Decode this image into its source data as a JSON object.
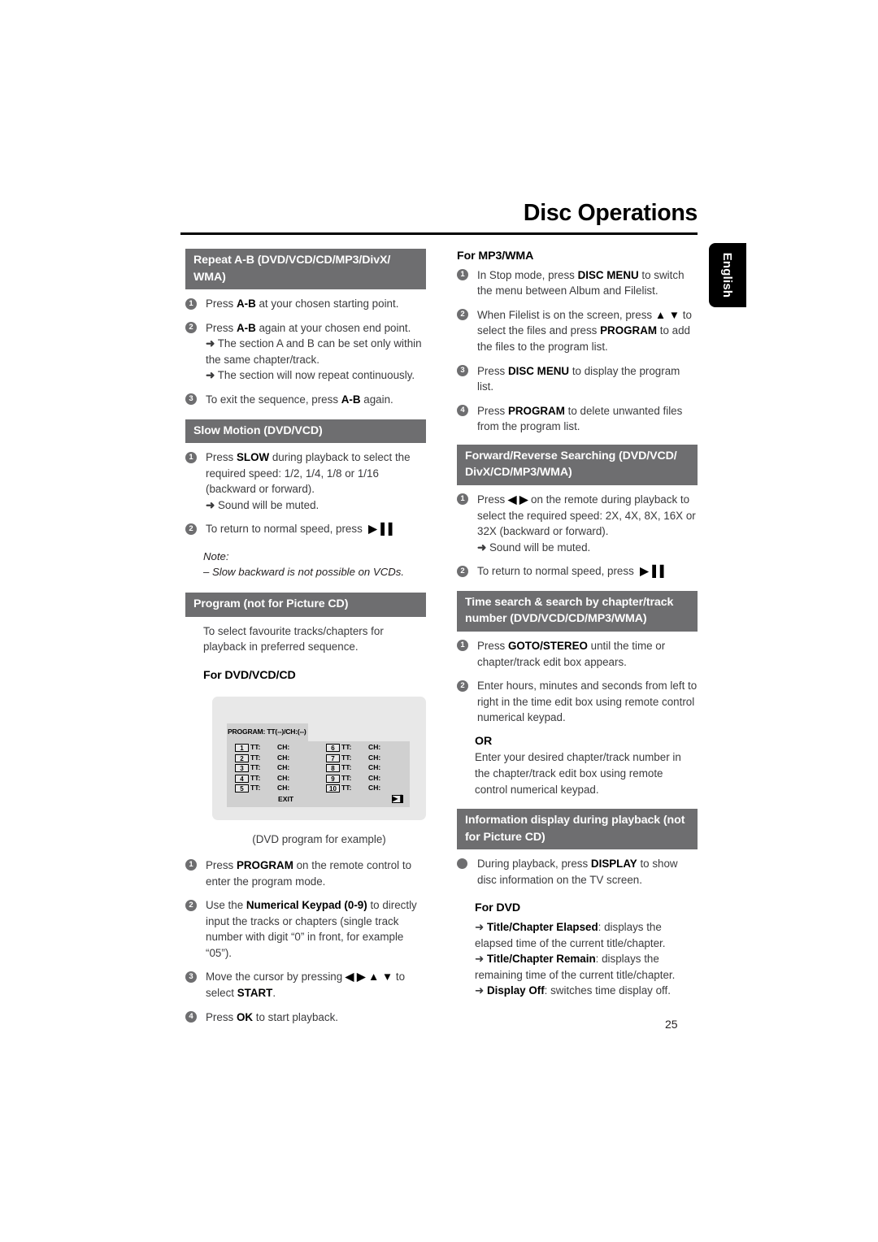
{
  "page": {
    "title": "Disc Operations",
    "number": "25",
    "language_tab": "English"
  },
  "left_column": {
    "repeat_ab": {
      "heading": "Repeat A-B (DVD/VCD/CD/MP3/DivX/ WMA)",
      "steps": [
        {
          "num": "1",
          "html": "Press <b>A-B</b> at your chosen starting point."
        },
        {
          "num": "2",
          "html": "Press <b>A-B</b> again at your chosen end point.<span class=\"arrowline\"><span class=\"ar\">➜</span> The section A and B can be set only within the same chapter/track.</span><span class=\"arrowline\"><span class=\"ar\">➜</span> The section will now repeat continuously.</span>"
        },
        {
          "num": "3",
          "html": "To exit the sequence, press <b>A-B</b> again."
        }
      ]
    },
    "slow_motion": {
      "heading": "Slow Motion (DVD/VCD)",
      "steps": [
        {
          "num": "1",
          "html": "Press <b>SLOW</b> during playback to select the required speed: 1/2, 1/4, 1/8 or 1/16 (backward or forward).<span class=\"arrowline\"><span class=\"ar\">➜</span> Sound will be muted.</span>"
        },
        {
          "num": "2",
          "html": "To return to normal speed, press &nbsp;<b>▶▐▐</b>"
        }
      ],
      "note_label": "Note:",
      "note_item": "–   Slow backward is not possible on VCDs."
    },
    "program": {
      "heading": "Program (not for Picture CD)",
      "intro": "To select favourite tracks/chapters for playback in preferred sequence.",
      "subhead": "For DVD/VCD/CD",
      "screen": {
        "title": "PROGRAM: TT(--)/CH:(--)",
        "rows": [
          {
            "left_idx": "1",
            "left_tt": "TT:",
            "left_ch": "CH:",
            "right_idx": "6",
            "right_tt": "TT:",
            "right_ch": "CH:"
          },
          {
            "left_idx": "2",
            "left_tt": "TT:",
            "left_ch": "CH:",
            "right_idx": "7",
            "right_tt": "TT:",
            "right_ch": "CH:"
          },
          {
            "left_idx": "3",
            "left_tt": "TT:",
            "left_ch": "CH:",
            "right_idx": "8",
            "right_tt": "TT:",
            "right_ch": "CH:"
          },
          {
            "left_idx": "4",
            "left_tt": "TT:",
            "left_ch": "CH:",
            "right_idx": "9",
            "right_tt": "TT:",
            "right_ch": "CH:"
          },
          {
            "left_idx": "5",
            "left_tt": "TT:",
            "left_ch": "CH:",
            "right_idx": "10",
            "right_tt": "TT:",
            "right_ch": "CH:"
          }
        ],
        "exit_label": "EXIT",
        "next_icon": "▶▐"
      },
      "caption": "(DVD program for example)",
      "steps": [
        {
          "num": "1",
          "html": "Press <b>PROGRAM</b> on the remote control to enter the program mode."
        },
        {
          "num": "2",
          "html": "Use the <b>Numerical Keypad (0-9)</b> to directly input the tracks or chapters (single track number with digit “0” in front, for example “05”)."
        },
        {
          "num": "3",
          "html": "Move the cursor by pressing <b>◀ ▶ ▲ ▼</b> to select <b>START</b>."
        },
        {
          "num": "4",
          "html": "Press <b>OK</b> to start playback."
        }
      ]
    }
  },
  "right_column": {
    "mp3_wma": {
      "subhead": "For MP3/WMA",
      "steps": [
        {
          "num": "1",
          "html": "In Stop mode, press <b>DISC MENU</b> to switch the menu between Album and Filelist."
        },
        {
          "num": "2",
          "html": "When Filelist is on the screen, press <b>▲ ▼</b> to select the files and press <b>PROGRAM</b> to add the files to the program list."
        },
        {
          "num": "3",
          "html": "Press <b>DISC MENU</b> to display the program list."
        },
        {
          "num": "4",
          "html": "Press <b>PROGRAM</b> to delete unwanted files from the program list."
        }
      ]
    },
    "searching": {
      "heading": "Forward/Reverse Searching (DVD/VCD/ DivX/CD/MP3/WMA)",
      "steps": [
        {
          "num": "1",
          "html": "Press <b>◀ ▶</b> on the remote during playback to select the required speed: 2X, 4X, 8X, 16X or 32X (backward or forward).<span class=\"arrowline\"><span class=\"ar\">➜</span> Sound will be muted.</span>"
        },
        {
          "num": "2",
          "html": "To return to normal speed, press &nbsp;<b>▶▐▐</b>"
        }
      ]
    },
    "time_search": {
      "heading": "Time search & search by chapter/track number (DVD/VCD/CD/MP3/WMA)",
      "steps": [
        {
          "num": "1",
          "html": "Press <b>GOTO/STEREO</b> until the time or chapter/track edit box appears."
        },
        {
          "num": "2",
          "html": "Enter hours, minutes and seconds from left to right in the time edit box using remote control numerical keypad."
        }
      ],
      "or_label": "OR",
      "or_body": "Enter your desired chapter/track number in the chapter/track edit box using remote control numerical keypad."
    },
    "info_display": {
      "heading": "Information display during playback (not for Picture CD)",
      "bullet": "During playback, press <b>DISPLAY</b> to show disc information on the TV screen.",
      "dvd_subhead": "For DVD",
      "dvd_items": [
        "<span class=\"ar\">➜</span> <b>Title/Chapter Elapsed</b>: displays the elapsed time of the current title/chapter.",
        "<span class=\"ar\">➜</span> <b>Title/Chapter Remain</b>: displays the remaining time of the current title/chapter.",
        "<span class=\"ar\">➜</span> <b>Display Off</b>: switches time display off."
      ]
    }
  },
  "colors": {
    "section_bar": "#6e6e70",
    "body_text": "#3b3b3d",
    "heading_text": "#000000",
    "tab_bg": "#000000",
    "screen_bg": "#e8e8e8",
    "screen_grid": "#d0d0d0"
  }
}
